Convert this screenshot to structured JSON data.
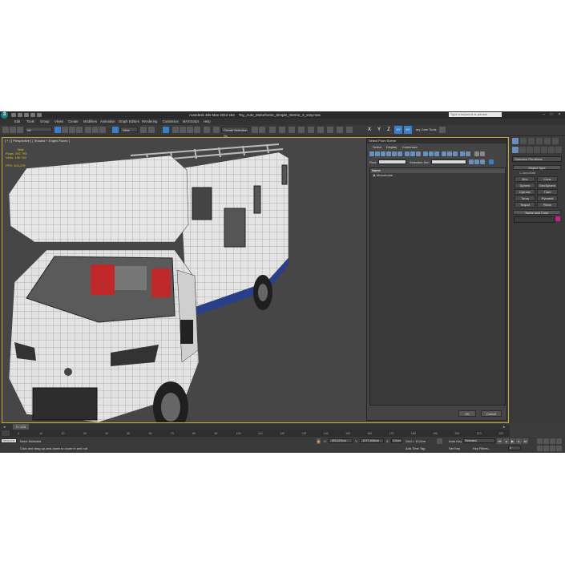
{
  "window": {
    "app_name": "Autodesk 3ds Max 2012 x64",
    "file_name": "Toy_Auto_Motorhome_Simple_Interior_3_vray.max",
    "search_placeholder": "Type a keyword or phrase"
  },
  "menubar": {
    "items": [
      "Edit",
      "Tools",
      "Group",
      "Views",
      "Create",
      "Modifiers",
      "Animation",
      "Graph Editors",
      "Rendering",
      "Customize",
      "MAXScript",
      "Help"
    ]
  },
  "toolbar": {
    "selection_filter": "All",
    "reference_coord": "View",
    "named_selection": "Create Selection Se",
    "axis_labels": [
      "X",
      "Y",
      "Z",
      "XY",
      "XY"
    ],
    "camera_tools": "ary Cam Tools"
  },
  "viewport": {
    "label": "[ + ] [ Perspective ] [ Shaded + Edged Faces ]",
    "stats": {
      "total_label": "Total",
      "polys_label": "Polys:",
      "polys_value": "292 799",
      "verts_label": "Verts:",
      "verts_value": "156 749",
      "fps_label": "FPS:",
      "fps_value": "103,279"
    }
  },
  "select_dialog": {
    "title": "Select From Scene",
    "tabs": [
      "Select",
      "Display",
      "Customize"
    ],
    "find_label": "Find:",
    "selection_set_label": "Selection Set:",
    "column_header": "Name",
    "items": [
      "Motorhome"
    ],
    "ok_label": "OK",
    "cancel_label": "Cancel"
  },
  "command_panel": {
    "category": "Standard Primitives",
    "object_type_title": "Object Type",
    "autogrid_label": "AutoGrid",
    "buttons": [
      "Box",
      "Cone",
      "Sphere",
      "GeoSphere",
      "Cylinder",
      "Tube",
      "Torus",
      "Pyramid",
      "Teapot",
      "Plane"
    ],
    "name_color_title": "Name and Color"
  },
  "timeline": {
    "frame_display": "0 / 225",
    "ticks": [
      "0",
      "10",
      "20",
      "30",
      "40",
      "50",
      "60",
      "70",
      "80",
      "90",
      "100",
      "110",
      "120",
      "130",
      "140",
      "150",
      "160",
      "170",
      "180",
      "190",
      "200",
      "210",
      "220"
    ]
  },
  "statusbar": {
    "welcome": "Welco",
    "welcome2": "me t",
    "none_selected": "None Selected",
    "prompt": "Click and drag up-and-down to zoom in and out",
    "x_label": "X:",
    "x_value": "-183,623cm",
    "y_label": "Y:",
    "y_value": "-1072,806cm",
    "z_label": "Z:",
    "z_value": "0,0cm",
    "grid": "Grid = 10,0cm",
    "auto_key": "Auto Key",
    "selected": "Selected",
    "set_key": "Set Key",
    "key_filters": "Key Filters...",
    "add_time_tag": "Add Time Tag",
    "frame": "0"
  }
}
